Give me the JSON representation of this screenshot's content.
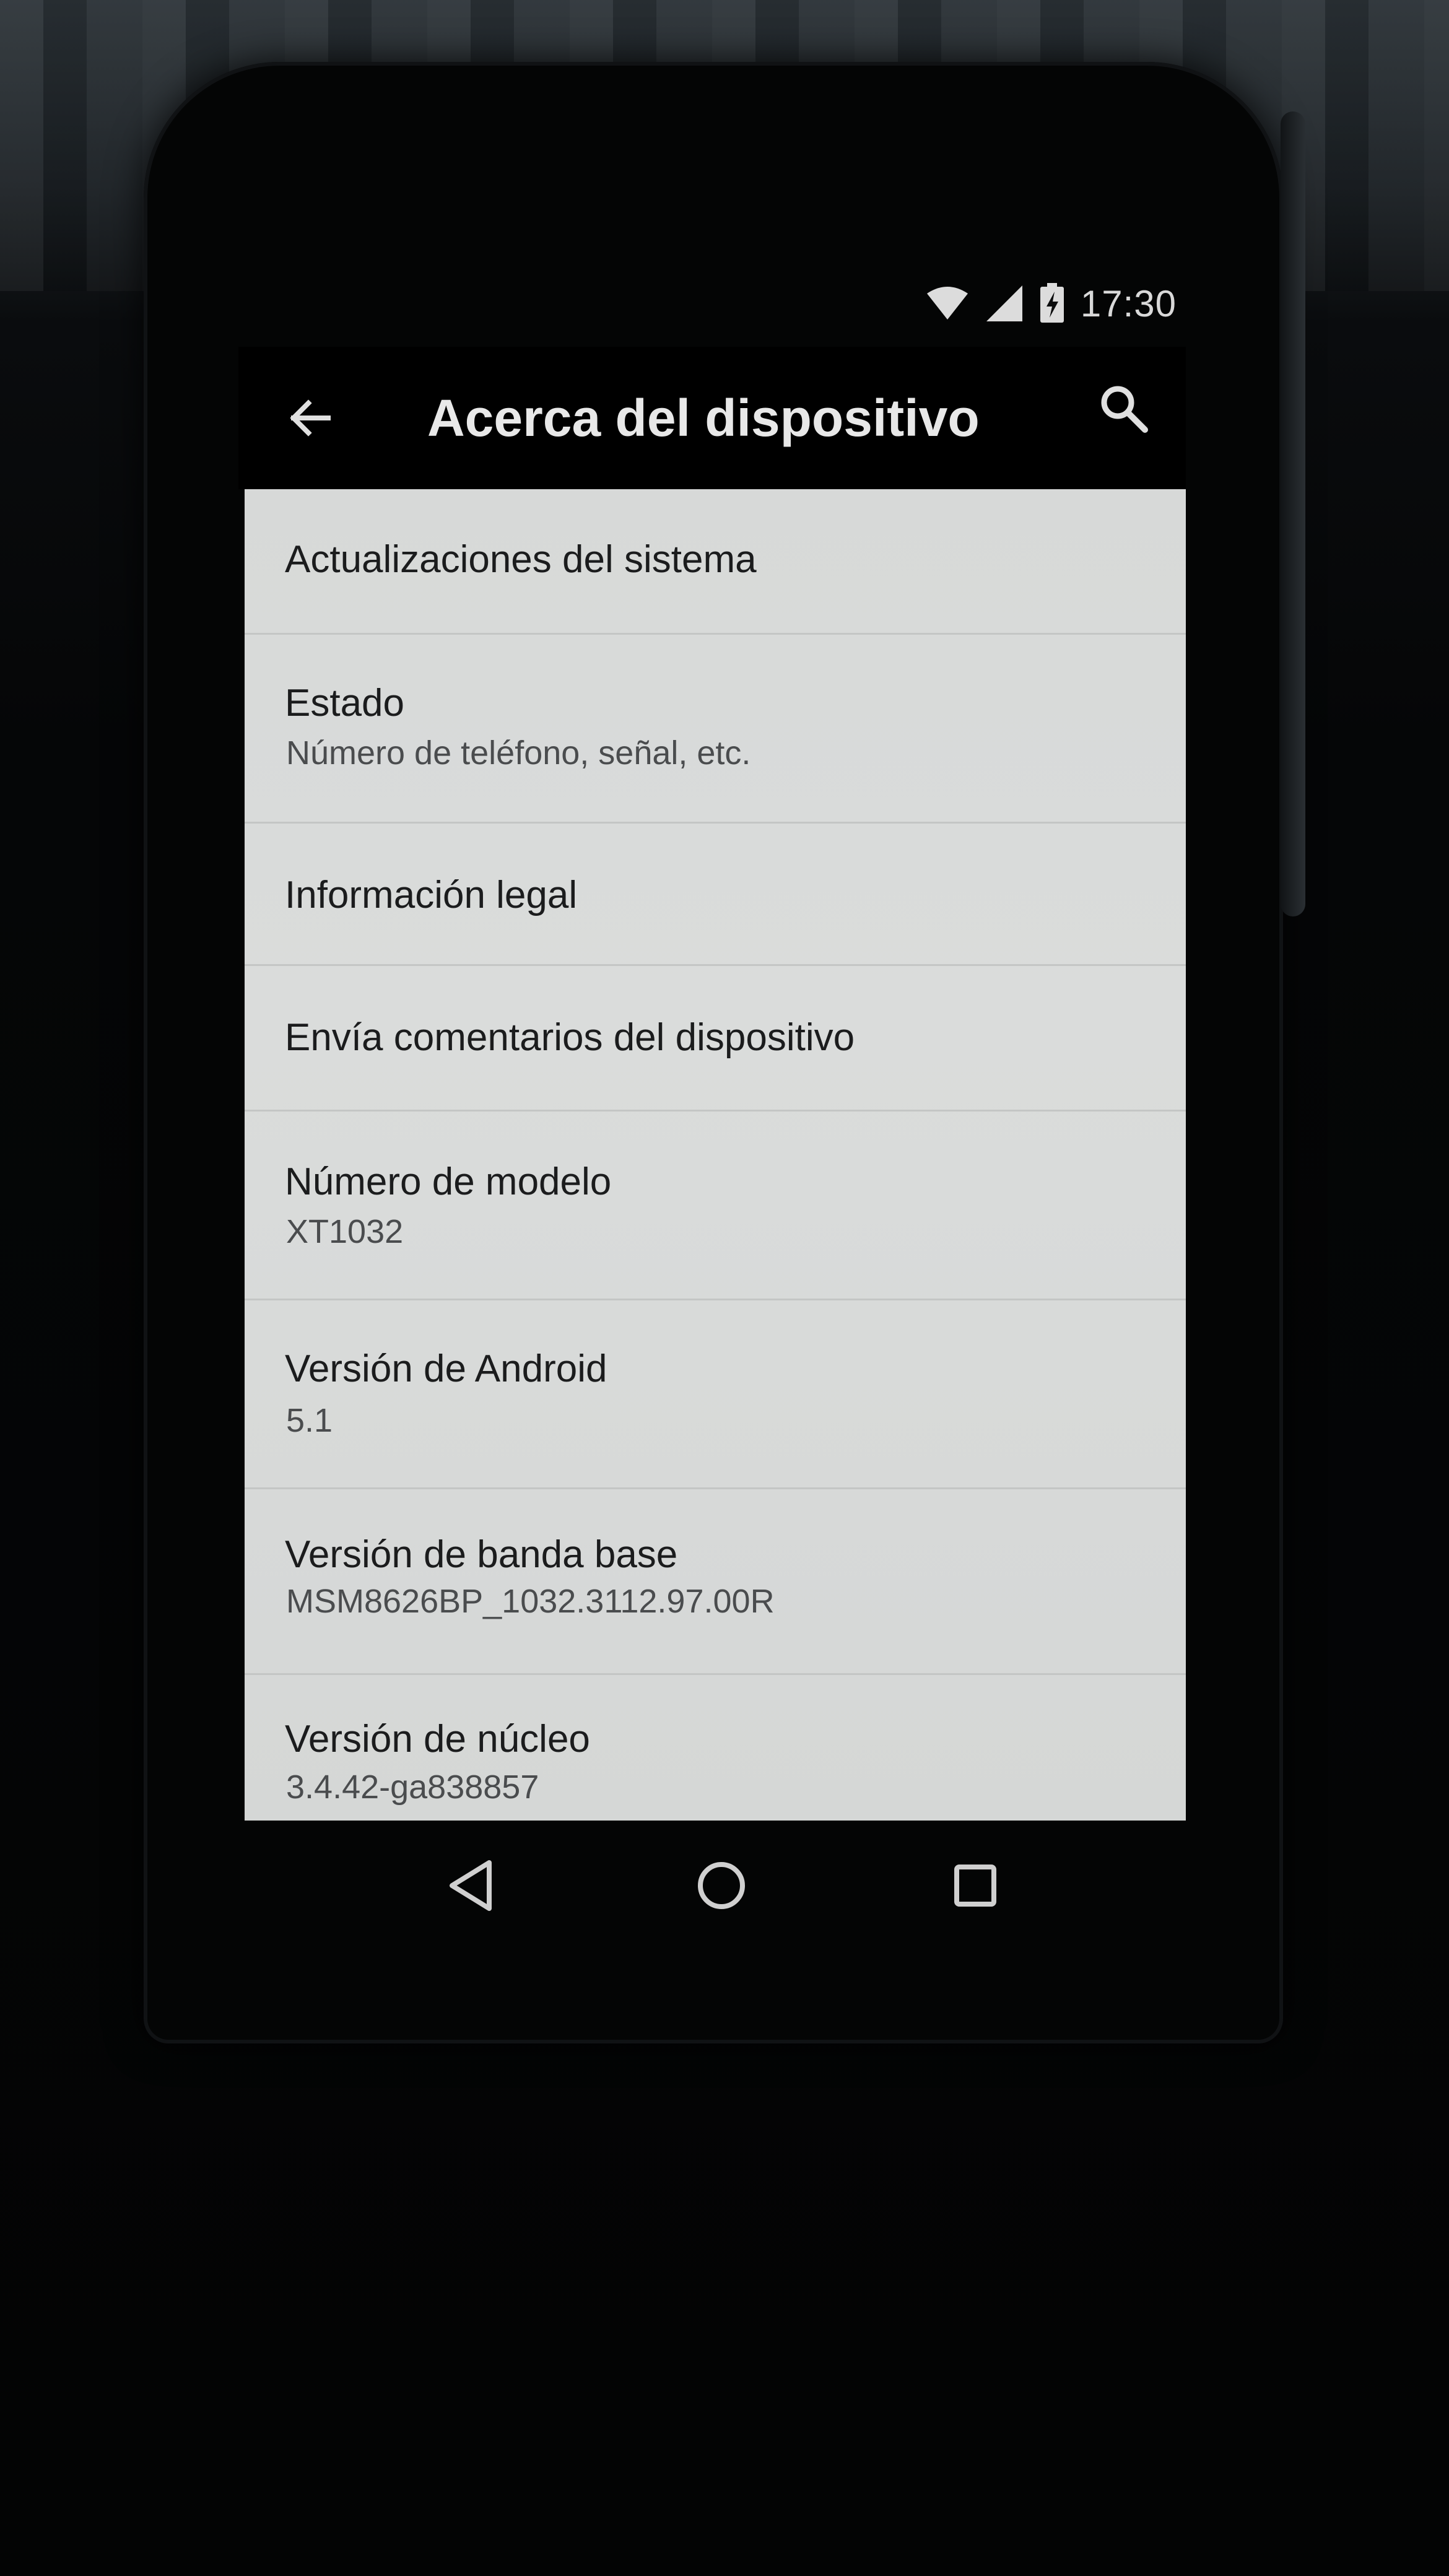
{
  "status_bar": {
    "time": "17:30",
    "icons": [
      "wifi-icon",
      "cell-signal-icon",
      "battery-charging-icon"
    ]
  },
  "app_bar": {
    "title": "Acerca del dispositivo",
    "back_icon": "arrow-back-icon",
    "search_icon": "search-icon"
  },
  "items": [
    {
      "title": "Actualizaciones del sistema",
      "subtitle": ""
    },
    {
      "title": "Estado",
      "subtitle": "Número de teléfono, señal, etc."
    },
    {
      "title": "Información legal",
      "subtitle": ""
    },
    {
      "title": "Envía comentarios del dispositivo",
      "subtitle": ""
    },
    {
      "title": "Número de modelo",
      "subtitle": "XT1032"
    },
    {
      "title": "Versión de Android",
      "subtitle": "5.1"
    },
    {
      "title": "Versión de banda base",
      "subtitle": "MSM8626BP_1032.3112.97.00R"
    },
    {
      "title": "Versión de núcleo",
      "subtitle": "3.4.42-ga838857"
    }
  ],
  "nav_bar": {
    "icons": [
      "nav-back-icon",
      "nav-home-icon",
      "nav-recents-icon"
    ]
  },
  "colors": {
    "app_bar": "#000000",
    "list_background": "#d8dad9",
    "primary_text": "#1b1c1d",
    "secondary_text": "#4a4c4e"
  }
}
